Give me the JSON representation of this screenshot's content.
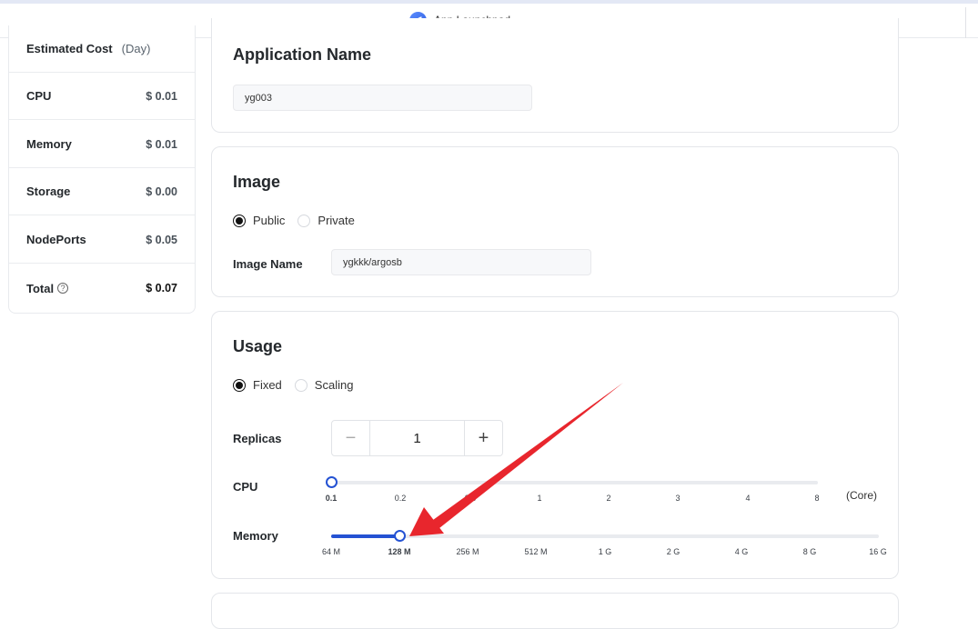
{
  "topbar": {
    "title": "App Launchpad",
    "icon": "rocket-icon"
  },
  "cost": {
    "header_label": "Estimated Cost",
    "header_period": "(Day)",
    "rows": [
      {
        "label": "CPU",
        "value": "$ 0.01"
      },
      {
        "label": "Memory",
        "value": "$ 0.01"
      },
      {
        "label": "Storage",
        "value": "$ 0.00"
      },
      {
        "label": "NodePorts",
        "value": "$ 0.05"
      }
    ],
    "total_label": "Total",
    "total_value": "$ 0.07",
    "help_glyph": "?"
  },
  "app_name": {
    "heading": "Application Name",
    "value": "yg003"
  },
  "image": {
    "heading": "Image",
    "options": [
      "Public",
      "Private"
    ],
    "selected": "Public",
    "name_label": "Image Name",
    "name_value": "ygkkk/argosb"
  },
  "usage": {
    "heading": "Usage",
    "options": [
      "Fixed",
      "Scaling"
    ],
    "selected": "Fixed",
    "replicas_label": "Replicas",
    "replicas_value": "1",
    "minus_glyph": "−",
    "plus_glyph": "+",
    "cpu_label": "CPU",
    "cpu_unit": "(Core)",
    "cpu_ticks": [
      "0.1",
      "0.2",
      "0.5",
      "1",
      "2",
      "3",
      "4",
      "8"
    ],
    "cpu_selected": "0.1",
    "memory_label": "Memory",
    "memory_ticks": [
      "64 M",
      "128 M",
      "256 M",
      "512 M",
      "1 G",
      "2 G",
      "4 G",
      "8 G",
      "16 G"
    ],
    "memory_selected": "128 M"
  },
  "colors": {
    "accent": "#2452d3",
    "annotation_arrow": "#e8262d"
  }
}
